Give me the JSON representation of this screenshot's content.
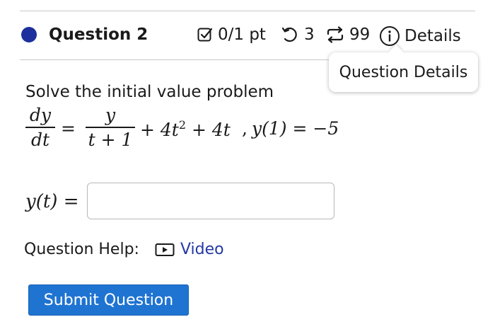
{
  "question": {
    "title": "Question 2",
    "points": "0/1 pt",
    "attempts": "3",
    "tries": "99",
    "details_label": "Details"
  },
  "tooltip": {
    "text": "Question Details"
  },
  "prompt": "Solve the initial value problem",
  "equation": {
    "lhs_num": "dy",
    "lhs_den": "dt",
    "equals": "=",
    "rhs_num": "y",
    "rhs_den": "t + 1",
    "rest": "+ 4t",
    "rest_exp": "2",
    "rest2": "+ 4t",
    "separator": ",",
    "initial": "y(1) = −5"
  },
  "answer": {
    "label": "y(t) =",
    "value": ""
  },
  "help": {
    "label": "Question Help:",
    "video_label": "Video"
  },
  "submit_label": "Submit Question",
  "colors": {
    "status_dot": "#1c2f9c",
    "link": "#2438a6",
    "submit_bg": "#1f74d2"
  },
  "icons": {
    "status": "filled-circle-icon",
    "points": "checkbox-icon",
    "attempts": "undo-icon",
    "tries": "repeat-icon",
    "details": "info-icon",
    "video": "video-play-icon"
  }
}
